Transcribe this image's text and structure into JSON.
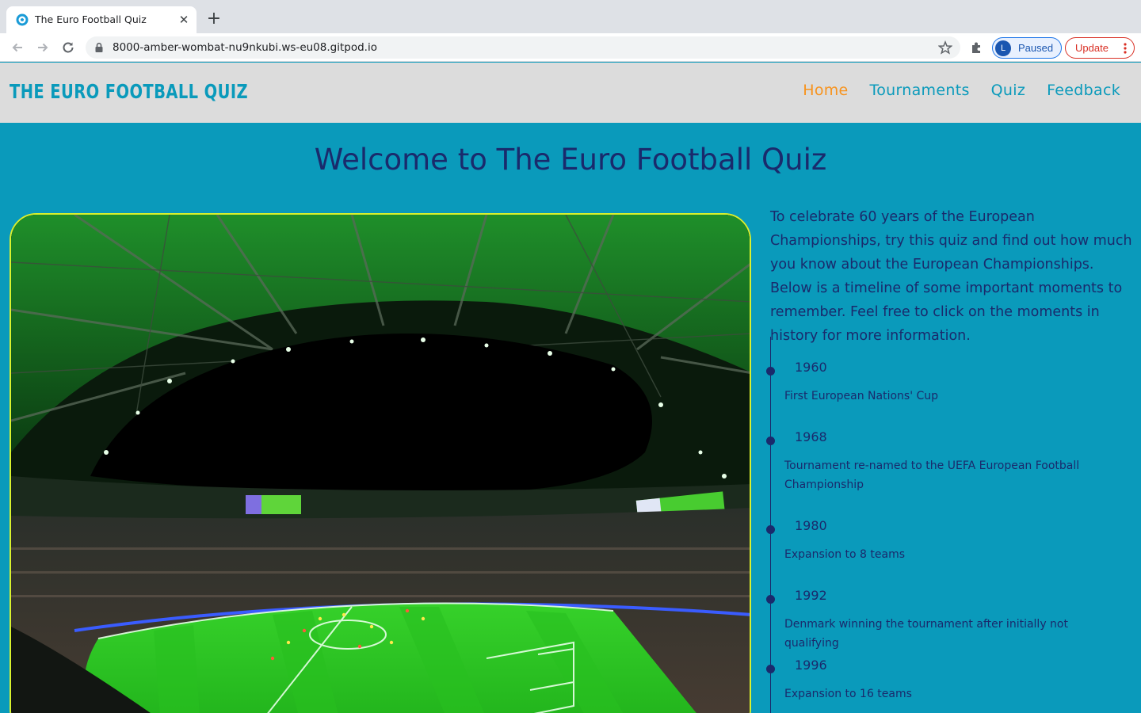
{
  "browser": {
    "tab_title": "The Euro Football Quiz",
    "url": "8000-amber-wombat-nu9nkubi.ws-eu08.gitpod.io",
    "profile_initial": "L",
    "profile_status": "Paused",
    "update_label": "Update"
  },
  "site": {
    "logo": "THE EURO FOOTBALL QUIZ",
    "nav": [
      "Home",
      "Tournaments",
      "Quiz",
      "Feedback"
    ]
  },
  "main": {
    "title": "Welcome to The Euro Football Quiz",
    "intro": "To celebrate 60 years of the European Championships, try this quiz and find out how much you know about the European Championships. Below is a timeline of some important moments to remember. Feel free to click on the moments in history for more information.",
    "timeline": [
      {
        "year": "1960",
        "text": "First European Nations' Cup"
      },
      {
        "year": "1968",
        "text": "Tournament re-named to the UEFA European Football Championship"
      },
      {
        "year": "1980",
        "text": "Expansion to 8 teams"
      },
      {
        "year": "1992",
        "text": "Denmark winning the tournament after initially not qualifying"
      },
      {
        "year": "1996",
        "text": "Expansion to 16 teams"
      }
    ]
  },
  "colors": {
    "page_bg": "#0a9abb",
    "header_bg": "#dcdcdc",
    "nav_active": "#f7931e",
    "text_dark": "#1a2a6c",
    "image_border": "#d8f02e"
  }
}
